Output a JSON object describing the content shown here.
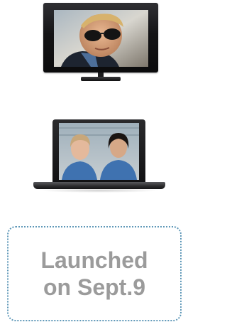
{
  "devices": [
    {
      "kind": "tv",
      "image_semantic": "man-with-sunglasses-scene"
    },
    {
      "kind": "laptop",
      "image_semantic": "two-women-in-scrubs-scene"
    }
  ],
  "launch": {
    "line1": "Launched",
    "line2": "on Sept.9",
    "text_color": "#9b9b9b",
    "border_color": "#5f98b8"
  }
}
